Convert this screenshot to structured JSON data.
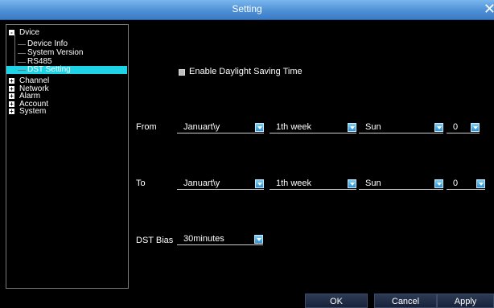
{
  "window": {
    "title": "Setting"
  },
  "tree": {
    "device": {
      "label": "Dvice",
      "children": [
        "Device Info",
        "System Version",
        "RS485",
        "DST Setting"
      ]
    },
    "groups": [
      "Channel",
      "Network",
      "Alarm",
      "Account",
      "System"
    ]
  },
  "dst": {
    "enable_label": "Enable Daylight Saving Time",
    "from": {
      "label": "From",
      "month": "Januart\\y",
      "week": "1th week",
      "day": "Sun",
      "hour": "0"
    },
    "to": {
      "label": "To",
      "month": "Januart\\y",
      "week": "1th week",
      "day": "Sun",
      "hour": "0"
    },
    "bias": {
      "label": "DST Bias",
      "value": "30minutes"
    }
  },
  "buttons": {
    "ok": "OK",
    "cancel": "Cancel",
    "apply": "Apply"
  },
  "colors": {
    "title_bar": "#4e90d6",
    "selection": "#1fd3e6",
    "background": "#000000"
  }
}
